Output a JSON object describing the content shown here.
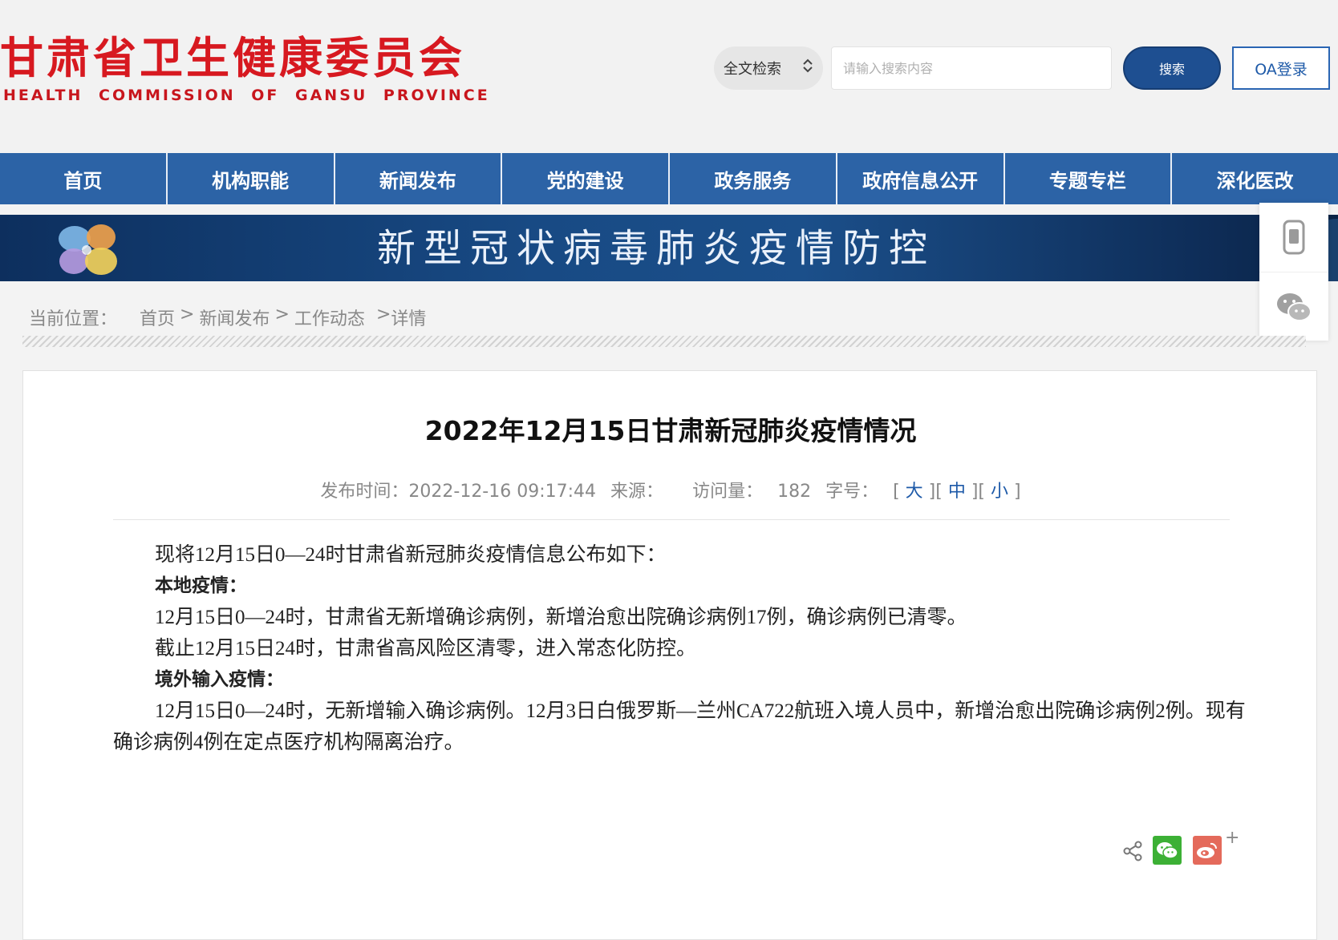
{
  "header": {
    "logo_cn": "甘肃省卫生健康委员会",
    "logo_en": "HEALTH COMMISSION OF GANSU PROVINCE",
    "search_select": "全文检索",
    "search_placeholder": "请输入搜索内容",
    "search_button": "搜索",
    "oa_button": "OA登录"
  },
  "nav": {
    "items": [
      "首页",
      "机构职能",
      "新闻发布",
      "党的建设",
      "政务服务",
      "政府信息公开",
      "专题专栏",
      "深化医改"
    ]
  },
  "banner": {
    "title": "新型冠状病毒肺炎疫情防控"
  },
  "breadcrumb": {
    "label": "当前位置：",
    "items": [
      "首页",
      "新闻发布",
      "工作动态",
      "详情"
    ],
    "sep": ">"
  },
  "article": {
    "title": "2022年12月15日甘肃新冠肺炎疫情情况",
    "meta": {
      "publish_label": "发布时间：",
      "publish_time": "2022-12-16 09:17:44",
      "source_label": "来源：",
      "views_label": "访问量：",
      "views": "182",
      "font_label": "字号：",
      "font_large": "大",
      "font_medium": "中",
      "font_small": "小"
    },
    "paragraphs": [
      "现将12月15日0—24时甘肃省新冠肺炎疫情信息公布如下：",
      "本地疫情：",
      "12月15日0—24时，甘肃省无新增确诊病例，新增治愈出院确诊病例17例，确诊病例已清零。",
      "截止12月15日24时，甘肃省高风险区清零，进入常态化防控。",
      "境外输入疫情：",
      "12月15日0—24时，无新增输入确诊病例。12月3日白俄罗斯—兰州CA722航班入境人员中，新增治愈出院确诊病例2例。现有确诊病例4例在定点医疗机构隔离治疗。"
    ]
  },
  "share": {
    "more": "+"
  },
  "colors": {
    "brand_red": "#d71920",
    "nav_blue": "#2c63a6",
    "search_blue": "#1e4f91"
  }
}
